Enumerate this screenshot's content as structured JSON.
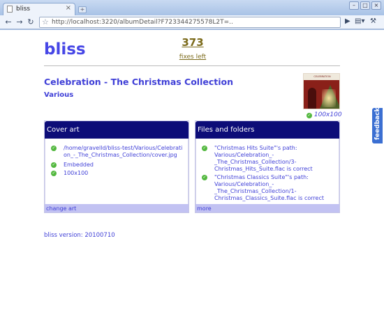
{
  "browser": {
    "tab_title": "bliss",
    "tab_close": "×",
    "new_tab": "+",
    "window_buttons": [
      "–",
      "□",
      "×"
    ],
    "url_host": "http://localhost",
    "url_rest": ":3220/albumDetail?F723344275578L2T=..",
    "icons": [
      "page-icon",
      "back-arrow-icon",
      "forward-arrow-icon",
      "reload-icon",
      "star-icon",
      "go-arrow-icon",
      "page-menu-icon",
      "wrench-icon"
    ]
  },
  "header": {
    "logo": "bliss",
    "fix_count": "373",
    "fix_label": "fixes left"
  },
  "album": {
    "title": "Celebration - The Christmas Collection",
    "artist": "Various",
    "cover_size": "100x100",
    "cover_band_text": "CELEBRATION"
  },
  "cover_panel": {
    "title": "Cover art",
    "items": [
      "/home/gravelld/bliss-test/Various/Celebration_-_The_Christmas_Collection/cover.jpg",
      "Embedded",
      "100x100"
    ],
    "footer": "change art"
  },
  "files_panel": {
    "title": "Files and folders",
    "items": [
      "\"Christmas Hits Suite\"'s path: Various/Celebration_-_The_Christmas_Collection/3-Christmas_Hits_Suite.flac is correct",
      "\"Christmas Classics Suite\"'s path: Various/Celebration_-_The_Christmas_Collection/1-Christmas_Classics_Suite.flac is correct"
    ],
    "footer": "more"
  },
  "feedback_label": "feedback",
  "version": "bliss version: 20100710",
  "colors": {
    "link_blue": "#3f3fd7",
    "panel_header": "#0d0d78",
    "panel_footer": "#c2c2f2",
    "check_green": "#53b83f",
    "fix_gold": "#7b6a1a"
  }
}
